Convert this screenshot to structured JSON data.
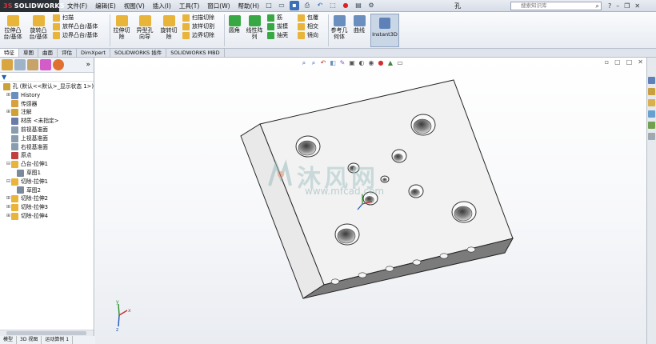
{
  "app": {
    "brand": "SOLIDWORKS",
    "document_title": "孔"
  },
  "menu": [
    "文件(F)",
    "编辑(E)",
    "视图(V)",
    "插入(I)",
    "工具(T)",
    "窗口(W)",
    "帮助(H)"
  ],
  "search": {
    "placeholder": "搜索知识库"
  },
  "command_manager": {
    "big_tools": [
      {
        "label": "拉伸凸台/基体",
        "color": "#e8b43a"
      },
      {
        "label": "旋转凸台/基体",
        "color": "#e8b43a"
      },
      {
        "label": "拉伸切除",
        "color": "#e8b43a"
      },
      {
        "label": "异型孔向导",
        "color": "#e8b43a"
      },
      {
        "label": "旋转切除",
        "color": "#e8b43a"
      },
      {
        "label": "圆角",
        "color": "#38a845"
      },
      {
        "label": "线性阵列",
        "color": "#38a845"
      },
      {
        "label": "参考几何体",
        "color": "#6a8fbf"
      },
      {
        "label": "曲线",
        "color": "#6a8fbf"
      }
    ],
    "stack_boss": [
      "扫描",
      "放样凸台/基体",
      "边界凸台/基体"
    ],
    "stack_cut": [
      "扫描切除",
      "放样切割",
      "边界切除"
    ],
    "stack_feature1": [
      "筋",
      "拔模",
      "抽壳"
    ],
    "stack_feature2": [
      "包覆",
      "相交",
      "镜向"
    ],
    "instant3d": "Instant3D"
  },
  "tabs": [
    {
      "label": "特征",
      "active": true
    },
    {
      "label": "草图",
      "active": false
    },
    {
      "label": "曲面",
      "active": false
    },
    {
      "label": "评估",
      "active": false
    },
    {
      "label": "DimXpert",
      "active": false
    },
    {
      "label": "SOLIDWORKS 插件",
      "active": false
    },
    {
      "label": "SOLIDWORKS MBD",
      "active": false
    }
  ],
  "tree": [
    {
      "label": "孔 (默认<<默认>_显示状态 1>)",
      "indent": 0,
      "exp": "",
      "color": "#c9a23a"
    },
    {
      "label": "History",
      "indent": 1,
      "exp": "+",
      "color": "#6a8fbf"
    },
    {
      "label": "传感器",
      "indent": 1,
      "exp": "",
      "color": "#d9a040"
    },
    {
      "label": "注解",
      "indent": 1,
      "exp": "+",
      "color": "#d0a030"
    },
    {
      "label": "材质 <未指定>",
      "indent": 1,
      "exp": "",
      "color": "#6c7aa8"
    },
    {
      "label": "前视基准面",
      "indent": 1,
      "exp": "",
      "color": "#8a9cb0"
    },
    {
      "label": "上视基准面",
      "indent": 1,
      "exp": "",
      "color": "#8a9cb0"
    },
    {
      "label": "右视基准面",
      "indent": 1,
      "exp": "",
      "color": "#8a9cb0"
    },
    {
      "label": "原点",
      "indent": 1,
      "exp": "",
      "color": "#c04040"
    },
    {
      "label": "凸台-拉伸1",
      "indent": 1,
      "exp": "-",
      "color": "#e8b43a"
    },
    {
      "label": "草图1",
      "indent": 2,
      "exp": "",
      "color": "#7a8a9a"
    },
    {
      "label": "切除-拉伸1",
      "indent": 1,
      "exp": "-",
      "color": "#e8b43a"
    },
    {
      "label": "草图2",
      "indent": 2,
      "exp": "",
      "color": "#7a8a9a"
    },
    {
      "label": "切除-拉伸2",
      "indent": 1,
      "exp": "+",
      "color": "#e8b43a"
    },
    {
      "label": "切除-拉伸3",
      "indent": 1,
      "exp": "+",
      "color": "#e8b43a"
    },
    {
      "label": "切除-拉伸4",
      "indent": 1,
      "exp": "+",
      "color": "#e8b43a"
    }
  ],
  "bottom_tabs": [
    "模型",
    "3D 视图",
    "运动算例 1"
  ],
  "watermark": {
    "text": "沐风网",
    "url": "www.mfcad.com"
  }
}
